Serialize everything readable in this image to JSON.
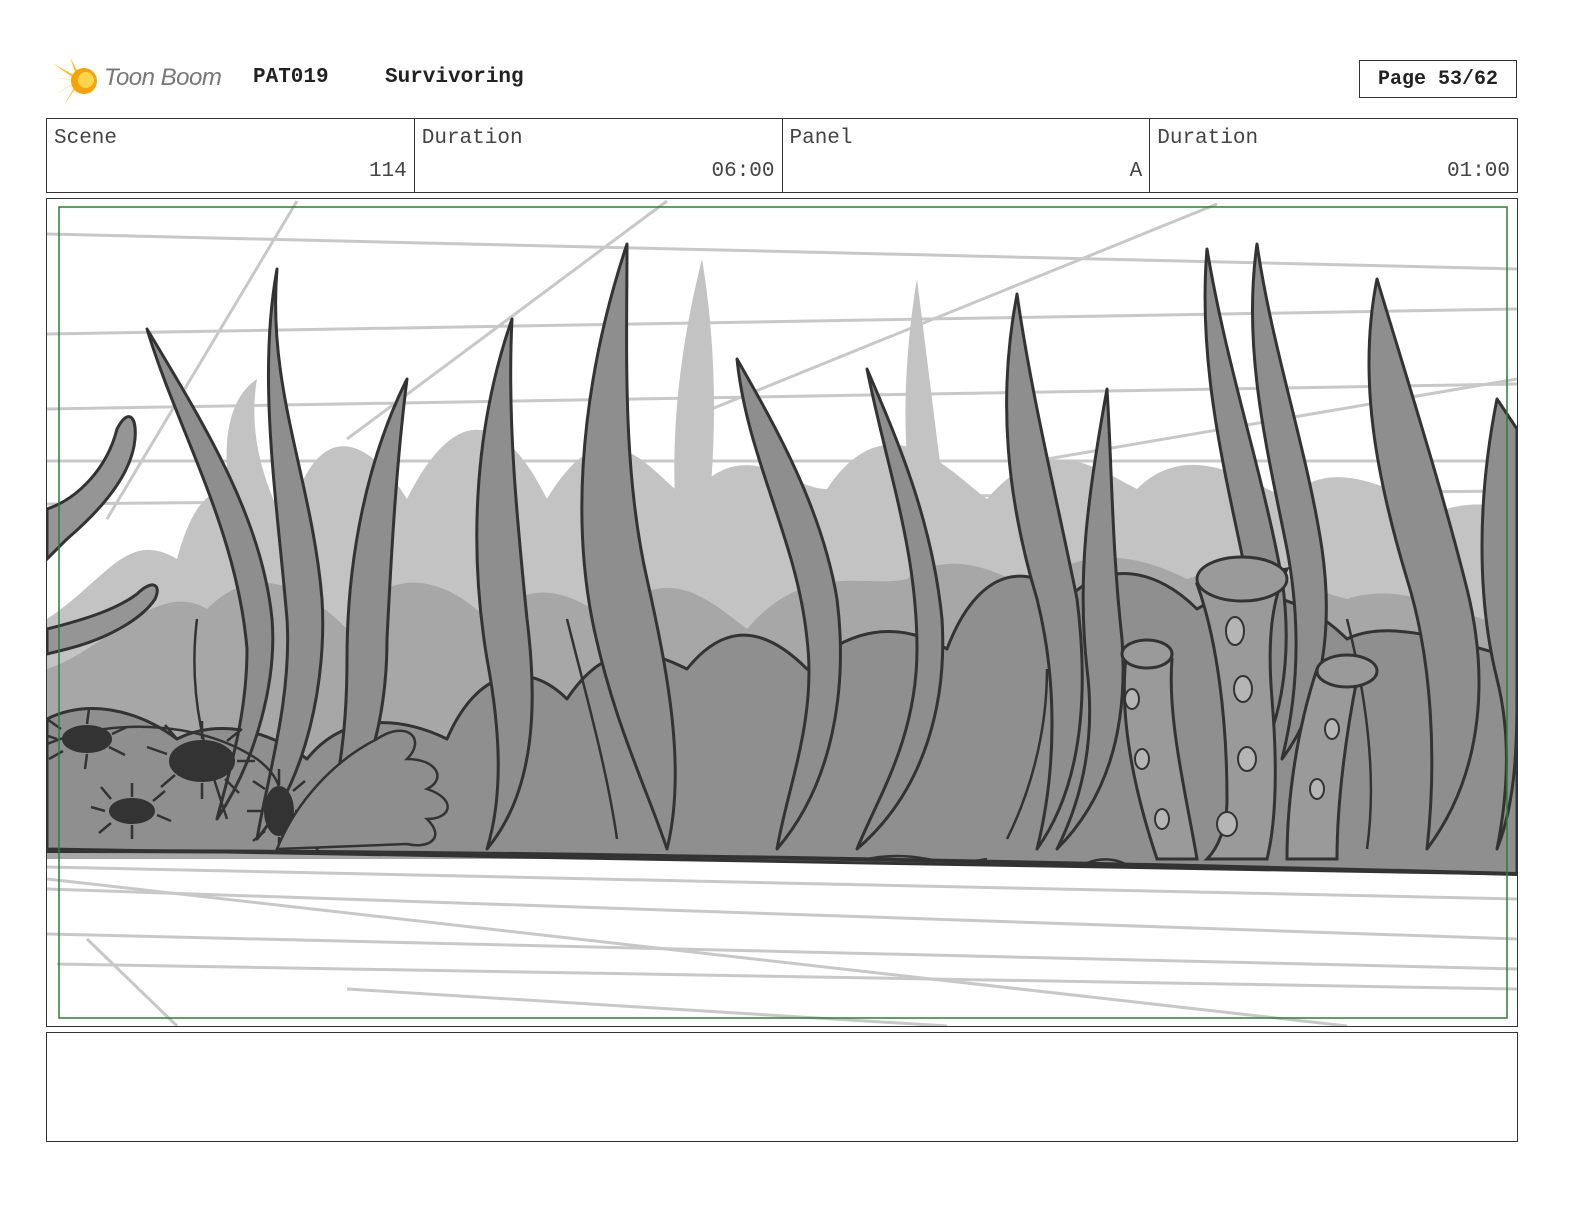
{
  "header": {
    "logo_text": "Toon Boom",
    "project_code": "PAT019",
    "project_title": "Survivoring",
    "page_label": "Page 53/62"
  },
  "info": {
    "scene_label": "Scene",
    "scene_value": "114",
    "duration_label": "Duration",
    "duration_value": "06:00",
    "panel_label": "Panel",
    "panel_value": "A",
    "panel_duration_label": "Duration",
    "panel_duration_value": "01:00"
  },
  "panel": {
    "image_icon": "seaweed-reef-drawing",
    "safe_frame_color": "#2e7d32"
  },
  "notes": {
    "text": ""
  }
}
